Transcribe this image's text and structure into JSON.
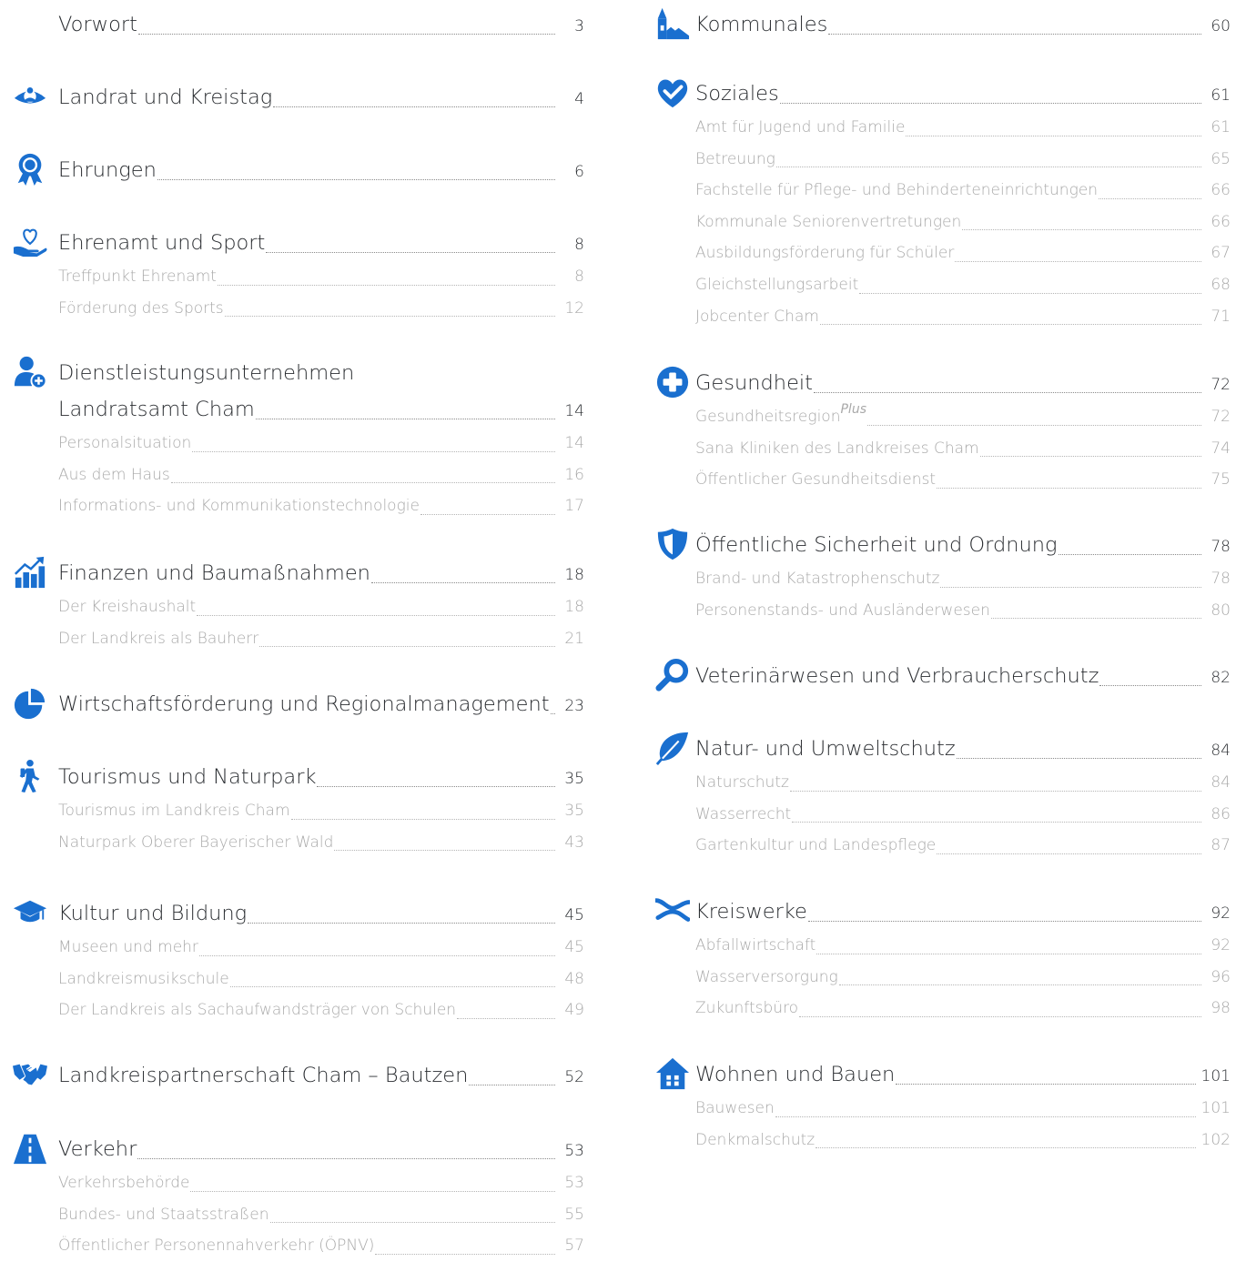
{
  "accent_color": "#1a6fcf",
  "left_column": [
    {
      "icon": "none",
      "title": "Vorwort",
      "page": "3",
      "items": []
    },
    {
      "icon": "person-eye-icon",
      "title": "Landrat und Kreistag",
      "page": "4",
      "items": []
    },
    {
      "icon": "award-rosette-icon",
      "title": "Ehrungen",
      "page": "6",
      "items": []
    },
    {
      "icon": "heart-hand-icon",
      "title": "Ehrenamt und Sport",
      "page": "8",
      "items": [
        {
          "title": "Treffpunkt Ehrenamt",
          "page": "8"
        },
        {
          "title": "Förderung des Sports",
          "page": "12"
        }
      ]
    },
    {
      "icon": "user-plus-icon",
      "title_line1": "Dienstleistungsunternehmen",
      "title": "Landratsamt Cham",
      "page": "14",
      "items": [
        {
          "title": "Personalsituation",
          "page": "14"
        },
        {
          "title": "Aus dem Haus",
          "page": "16"
        },
        {
          "title": "Informations- und Kommunikationstechnologie",
          "page": "17"
        }
      ]
    },
    {
      "icon": "bar-chart-icon",
      "title": "Finanzen und Baumaßnahmen",
      "page": "18",
      "items": [
        {
          "title": "Der Kreishaushalt",
          "page": "18"
        },
        {
          "title": "Der Landkreis als Bauherr",
          "page": "21"
        }
      ]
    },
    {
      "icon": "pie-chart-icon",
      "title": "Wirtschaftsförderung und Regionalmanagement",
      "page": "23",
      "items": []
    },
    {
      "icon": "hiker-icon",
      "title": "Tourismus und Naturpark",
      "page": "35",
      "items": [
        {
          "title": "Tourismus im Landkreis Cham",
          "page": "35"
        },
        {
          "title": "Naturpark Oberer Bayerischer Wald",
          "page": "43"
        }
      ]
    },
    {
      "icon": "graduation-cap-icon",
      "title": "Kultur und Bildung",
      "page": "45",
      "items": [
        {
          "title": "Museen und mehr",
          "page": "45"
        },
        {
          "title": "Landkreismusikschule",
          "page": "48"
        },
        {
          "title": "Der Landkreis als Sachaufwandsträger von Schulen",
          "page": "49"
        }
      ]
    },
    {
      "icon": "handshake-icon",
      "title": "Landkreispartnerschaft Cham – Bautzen",
      "page": "52",
      "items": []
    },
    {
      "icon": "road-icon",
      "title": "Verkehr",
      "page": "53",
      "items": [
        {
          "title": "Verkehrsbehörde",
          "page": "53"
        },
        {
          "title": "Bundes- und Staatsstraßen",
          "page": "55"
        },
        {
          "title": "Öffentlicher Personennahverkehr (ÖPNV)",
          "page": "57"
        }
      ]
    }
  ],
  "right_column": [
    {
      "icon": "church-village-icon",
      "title": "Kommunales",
      "page": "60",
      "items": []
    },
    {
      "icon": "heart-check-icon",
      "title": "Soziales",
      "page": "61",
      "items": [
        {
          "title": "Amt für Jugend und Familie",
          "page": "61"
        },
        {
          "title": "Betreuung",
          "page": "65"
        },
        {
          "title": "Fachstelle für Pflege- und Behinderteneinrichtungen",
          "page": "66"
        },
        {
          "title": "Kommunale Seniorenvertretungen",
          "page": "66"
        },
        {
          "title": "Ausbildungsförderung für Schüler",
          "page": "67"
        },
        {
          "title": "Gleichstellungsarbeit",
          "page": "68"
        },
        {
          "title": "Jobcenter Cham",
          "page": "71"
        }
      ]
    },
    {
      "icon": "medical-cross-icon",
      "title": "Gesundheit",
      "page": "72",
      "items": [
        {
          "title": "Gesundheitsregion",
          "title_sup": "Plus",
          "page": "72"
        },
        {
          "title": "Sana Kliniken des Landkreises Cham",
          "page": "74"
        },
        {
          "title": "Öffentlicher Gesundheitsdienst",
          "page": "75"
        }
      ]
    },
    {
      "icon": "shield-icon",
      "title": "Öffentliche Sicherheit und Ordnung",
      "page": "78",
      "items": [
        {
          "title": "Brand- und Katastrophenschutz",
          "page": "78"
        },
        {
          "title": "Personenstands- und Ausländerwesen",
          "page": "80"
        }
      ]
    },
    {
      "icon": "magnifier-icon",
      "title": "Veterinärwesen und Verbraucherschutz",
      "page": "82",
      "items": []
    },
    {
      "icon": "leaf-icon",
      "title": "Natur- und Umweltschutz",
      "page": "84",
      "items": [
        {
          "title": "Naturschutz",
          "page": "84"
        },
        {
          "title": "Wasserrecht",
          "page": "86"
        },
        {
          "title": "Gartenkultur und Landespflege",
          "page": "87"
        }
      ]
    },
    {
      "icon": "waves-icon",
      "title": "Kreiswerke",
      "page": "92",
      "items": [
        {
          "title": "Abfallwirtschaft",
          "page": "92"
        },
        {
          "title": "Wasserversorgung",
          "page": "96"
        },
        {
          "title": "Zukunftsbüro",
          "page": "98"
        }
      ]
    },
    {
      "icon": "house-icon",
      "title": "Wohnen und Bauen",
      "page": "101",
      "items": [
        {
          "title": "Bauwesen",
          "page": "101"
        },
        {
          "title": "Denkmalschutz",
          "page": "102"
        }
      ]
    }
  ]
}
